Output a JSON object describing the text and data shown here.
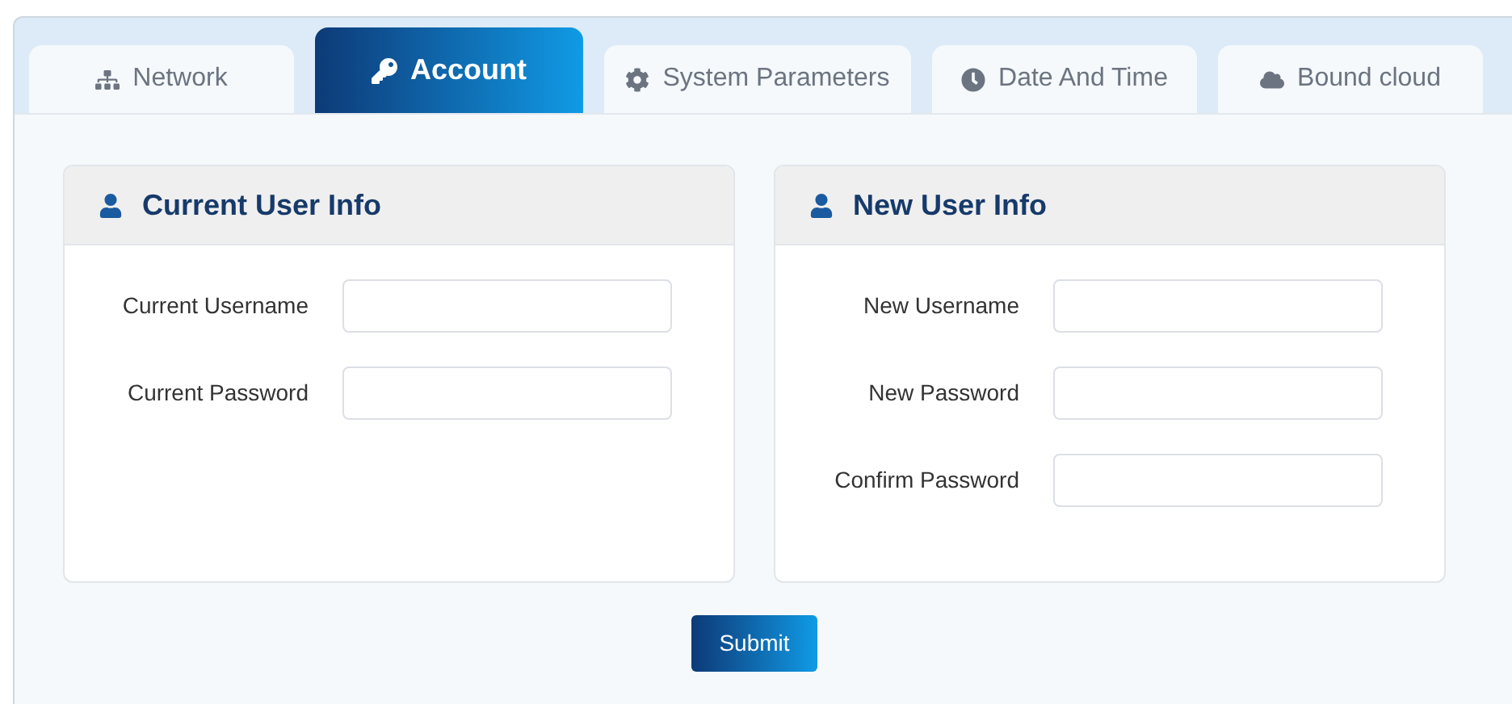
{
  "tabs": [
    {
      "label": "Network",
      "selected": false
    },
    {
      "label": "Account",
      "selected": true
    },
    {
      "label": "System Parameters",
      "selected": false
    },
    {
      "label": "Date And Time",
      "selected": false
    },
    {
      "label": "Bound cloud",
      "selected": false
    }
  ],
  "panels": [
    {
      "title": "Current User Info",
      "fields": [
        {
          "label": "Current Username"
        },
        {
          "label": "Current Password"
        }
      ]
    },
    {
      "title": "New User Info",
      "fields": [
        {
          "label": "New Username"
        },
        {
          "label": "New Password"
        },
        {
          "label": "Confirm Password"
        }
      ]
    }
  ],
  "submit_button": "Submit"
}
